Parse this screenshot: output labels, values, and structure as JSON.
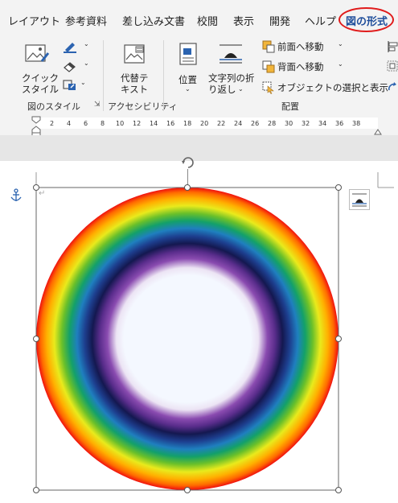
{
  "tabs": [
    "レイアウト",
    "参考資料",
    "差し込み文書",
    "校閲",
    "表示",
    "開発",
    "ヘルプ",
    "図の形式"
  ],
  "ribbon": {
    "quick_style_label": "クイック\nスタイル",
    "alt_text_label": "代替テ\nキスト",
    "position_label": "位置",
    "wrap_text_label": "文字列の折\nり返し",
    "bring_forward_label": "前面へ移動",
    "send_backward_label": "背面へ移動",
    "selection_pane_label": "オブジェクトの選択と表示",
    "group_picture_styles": "図のスタイル",
    "group_accessibility": "アクセシビリティ",
    "group_arrange": "配置"
  },
  "ruler_ticks": [
    "2",
    "4",
    "6",
    "8",
    "10",
    "12",
    "14",
    "16",
    "18",
    "20",
    "22",
    "24",
    "26",
    "28",
    "30",
    "32",
    "34",
    "36",
    "38"
  ],
  "colors": {
    "active_tab": "#1f4e9b",
    "highlight_ellipse": "#e01b1b",
    "accent_blue": "#2b63b0"
  }
}
